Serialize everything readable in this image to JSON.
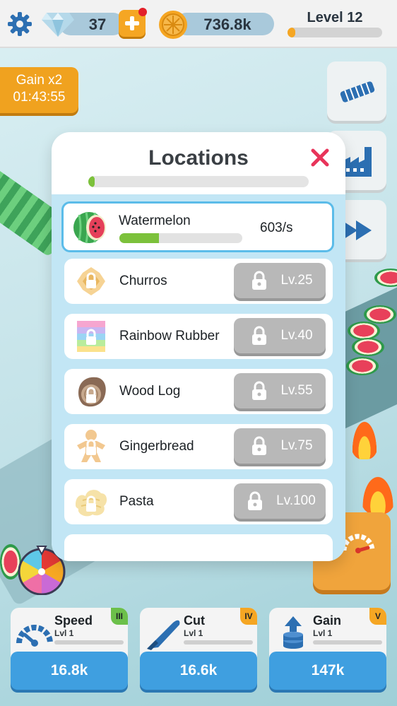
{
  "topbar": {
    "gems": "37",
    "coins": "736.8k",
    "level_label": "Level 12",
    "level_progress": 0.08
  },
  "gain_badge": {
    "title": "Gain x2",
    "timer": "01:43:55"
  },
  "modal": {
    "title": "Locations",
    "progress": 0.03,
    "locations": [
      {
        "name": "Watermelon",
        "rate": "603/s",
        "progress": 0.32,
        "active": true
      },
      {
        "name": "Churros",
        "lock_level": "Lv.25"
      },
      {
        "name": "Rainbow Rubber",
        "lock_level": "Lv.40"
      },
      {
        "name": "Wood Log",
        "lock_level": "Lv.55"
      },
      {
        "name": "Gingerbread",
        "lock_level": "Lv.75"
      },
      {
        "name": "Pasta",
        "lock_level": "Lv.100"
      }
    ]
  },
  "upgrades": [
    {
      "title": "Speed",
      "level": "Lvl 1",
      "tier": "III",
      "cost": "16.8k",
      "tier_color": "#6cc04a"
    },
    {
      "title": "Cut",
      "level": "Lvl 1",
      "tier": "IV",
      "cost": "16.6k",
      "tier_color": "#f5a623"
    },
    {
      "title": "Gain",
      "level": "Lvl 1",
      "tier": "V",
      "cost": "147k",
      "tier_color": "#f5a623"
    }
  ],
  "colors": {
    "accent_blue": "#3f9fe0",
    "accent_orange": "#f5a623",
    "progress_green": "#7cc13b",
    "close_red": "#e8345a",
    "list_bg": "#c2e6f5"
  }
}
